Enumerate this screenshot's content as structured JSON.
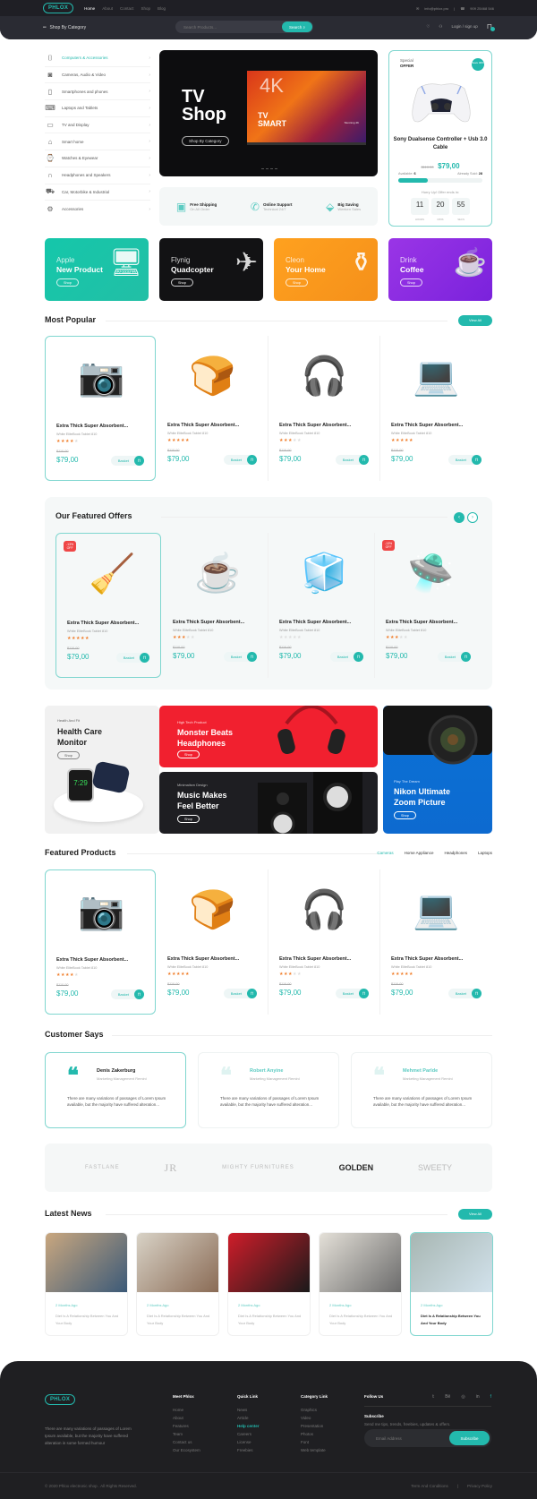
{
  "header": {
    "logo": "PHLOX",
    "nav": [
      "Home",
      "About",
      "Contact",
      "Shop",
      "Blog"
    ],
    "email": "info@phlox.pro",
    "phone": "909 25468 546",
    "category_button": "Shop By Category",
    "search_placeholder": "Search Products...",
    "search_button": "Search",
    "login": "Login / sign up",
    "accent_color": "#23b9ad"
  },
  "sidebar": {
    "items": [
      {
        "label": "Computers & Accessories",
        "icon": "mouse-icon",
        "active": true
      },
      {
        "label": "Cameras, Audio & Video",
        "icon": "camera-icon"
      },
      {
        "label": "Smartphones and phones",
        "icon": "smartphone-icon"
      },
      {
        "label": "Laptops and Tablets",
        "icon": "laptop-icon"
      },
      {
        "label": "TV and Display",
        "icon": "tv-icon"
      },
      {
        "label": "Smart home",
        "icon": "home-icon"
      },
      {
        "label": "Watches & Eyewear",
        "icon": "watch-icon"
      },
      {
        "label": "Headphones and Speakers",
        "icon": "headphones-icon"
      },
      {
        "label": "Car, Motorbike & Industrial",
        "icon": "car-icon"
      },
      {
        "label": "Accessories",
        "icon": "accessories-icon"
      }
    ]
  },
  "hero": {
    "title_line1": "TV",
    "title_line2": "Shop",
    "button": "Shop By Category",
    "tv_badge": "4K",
    "tv_text_line1": "TV",
    "tv_text_line2": "SMART",
    "tv_sub": "Stunning 4K"
  },
  "features": [
    {
      "title": "Free Shipping",
      "sub": "On All Order",
      "icon": "shipping-box-icon"
    },
    {
      "title": "Online Support",
      "sub": "Technical 24/7",
      "icon": "support-phone-icon"
    },
    {
      "title": "Big Saving",
      "sub": "Weeken Sales",
      "icon": "saving-tag-icon"
    }
  ],
  "special_offer": {
    "label_line1": "Special",
    "label_line2": "OFFER",
    "save_badge": "Save 30%",
    "title": "Sony Dualsense Controller + Usb 3.0 Cable",
    "old_price": "$110.00",
    "price": "$79,00",
    "available_label": "Available:",
    "available": "6",
    "sold_label": "Already Sold:",
    "sold": "28",
    "progress_percent": 35,
    "hurry_text": "Hurry Up! Offer ends in:",
    "timer": [
      {
        "value": "11",
        "unit": "HOURS"
      },
      {
        "value": "20",
        "unit": "MINS"
      },
      {
        "value": "55",
        "unit": "SECS"
      }
    ]
  },
  "promos": [
    {
      "line1": "Apple",
      "line2": "New Product",
      "button": "Shop",
      "color": "#1fc7a9"
    },
    {
      "line1": "Flynig",
      "line2": "Quadcopter",
      "button": "Shop",
      "color": "#141416"
    },
    {
      "line1": "Cleon",
      "line2": "Your Home",
      "button": "Shop",
      "color": "#f79a1e"
    },
    {
      "line1": "Drink",
      "line2": "Coffee",
      "button": "Shop",
      "color": "#8f2be0"
    }
  ],
  "most_popular": {
    "title": "Most Popular",
    "view_all": "View All",
    "products": [
      {
        "name": "Extra Thick Super Absorbent...",
        "sub": "White EliteBook Tablet 810",
        "rating": 4,
        "old_price": "$110.00",
        "price": "$79,00",
        "basket": "Basket",
        "image": "camera"
      },
      {
        "name": "Extra Thick Super Absorbent...",
        "sub": "White EliteBook Tablet 810",
        "rating": 5,
        "old_price": "$110.00",
        "price": "$79,00",
        "basket": "Basket",
        "image": "toaster"
      },
      {
        "name": "Extra Thick Super Absorbent...",
        "sub": "White EliteBook Tablet 810",
        "rating": 3,
        "old_price": "$110.00",
        "price": "$79,00",
        "basket": "Basket",
        "image": "headphones"
      },
      {
        "name": "Extra Thick Super Absorbent...",
        "sub": "White EliteBook Tablet 810",
        "rating": 5,
        "old_price": "$110.00",
        "price": "$79,00",
        "basket": "Basket",
        "image": "laptop"
      }
    ]
  },
  "featured_offers": {
    "title": "Our Featured Offers",
    "products": [
      {
        "name": "Extra Thick Super Absorbent...",
        "sub": "White EliteBook Tablet 810",
        "rating": 5,
        "old_price": "$110.00",
        "price": "$79,00",
        "basket": "Basket",
        "discount": "-13%",
        "discount_sub": "OFF",
        "image": "vacuum"
      },
      {
        "name": "Extra Thick Super Absorbent...",
        "sub": "White EliteBook Tablet 810",
        "rating": 3,
        "old_price": "$110.00",
        "price": "$79,00",
        "basket": "Basket",
        "image": "coffee-machine"
      },
      {
        "name": "Extra Thick Super Absorbent...",
        "sub": "White EliteBook Tablet 810",
        "rating": 0,
        "old_price": "$110.00",
        "price": "$79,00",
        "basket": "Basket",
        "image": "fridge"
      },
      {
        "name": "Extra Thick Super Absorbent...",
        "sub": "White EliteBook Tablet 810",
        "rating": 3,
        "old_price": "$110.00",
        "price": "$79,00",
        "basket": "Basket",
        "discount": "-13%",
        "discount_sub": "OFF",
        "image": "drone"
      }
    ]
  },
  "mosaic": {
    "health": {
      "kicker": "Health And Fit",
      "title_line1": "Health Care",
      "title_line2": "Monitor",
      "button": "Shop",
      "watch_time": "7:29"
    },
    "beats": {
      "kicker": "High Tech Product",
      "title_line1": "Monster Beats",
      "title_line2": "Headphones",
      "button": "Shop"
    },
    "music": {
      "kicker": "Minimalism Design",
      "title_line1": "Music Makes",
      "title_line2": "Feel Better",
      "button": "Shop"
    },
    "nikon": {
      "kicker": "Play The Dream",
      "title_line1": "Nikon Ultimate",
      "title_line2": "Zoom Picture",
      "button": "Shop"
    }
  },
  "featured_products": {
    "title": "Featured Products",
    "tabs": [
      "Cameras",
      "Home Appliance",
      "Headphones",
      "Laptops"
    ],
    "products": [
      {
        "name": "Extra Thick Super Absorbent...",
        "sub": "White EliteBook Tablet 810",
        "rating": 4,
        "old_price": "$110.00",
        "price": "$79,00",
        "basket": "Basket",
        "image": "camera"
      },
      {
        "name": "Extra Thick Super Absorbent...",
        "sub": "White EliteBook Tablet 810",
        "rating": 5,
        "old_price": "$110.00",
        "price": "$79,00",
        "basket": "Basket",
        "image": "toaster"
      },
      {
        "name": "Extra Thick Super Absorbent...",
        "sub": "White EliteBook Tablet 810",
        "rating": 3,
        "old_price": "$110.00",
        "price": "$79,00",
        "basket": "Basket",
        "image": "headphones"
      },
      {
        "name": "Extra Thick Super Absorbent...",
        "sub": "White EliteBook Tablet 810",
        "rating": 5,
        "old_price": "$110.00",
        "price": "$79,00",
        "basket": "Basket",
        "image": "laptop"
      }
    ]
  },
  "testimonials": {
    "title": "Customer Says",
    "items": [
      {
        "name": "Denis Zakerburg",
        "role": "Marketing Management Remini",
        "text": "There are many variations of passages of Lorem Ipsum available, but the majority have suffered alteration..."
      },
      {
        "name": "Robert Anyine",
        "role": "Marketing Management Remini",
        "text": "There are many variations of passages of Lorem Ipsum available, but the majority have suffered alteration..."
      },
      {
        "name": "Mehmet Parlde",
        "role": "Marketing Management Remini",
        "text": "There are many variations of passages of Lorem Ipsum available, but the majority have suffered alteration..."
      }
    ]
  },
  "brands": [
    "FASTLANE",
    "JR",
    "MIGHTY FURNITURES",
    "GOLDEN",
    "SWEETY"
  ],
  "news": {
    "title": "Latest News",
    "view_all": "View All",
    "items": [
      {
        "ago": "2 Months Ago",
        "title": "Diet Is A Relationship Between You And Your Body",
        "colors": [
          "#c9a77f",
          "#3c5a78"
        ]
      },
      {
        "ago": "2 Months Ago",
        "title": "Diet Is A Relationship Between You And Your Body",
        "colors": [
          "#d8d2c6",
          "#8a6b55"
        ]
      },
      {
        "ago": "2 Months Ago",
        "title": "Diet Is A Relationship Between You And Your Body",
        "colors": [
          "#cf1d2a",
          "#1a1a1a"
        ]
      },
      {
        "ago": "2 Months Ago",
        "title": "Diet Is A Relationship Between You And Your Body",
        "colors": [
          "#e4e0d8",
          "#6b6b6b"
        ]
      },
      {
        "ago": "2 Months Ago",
        "title": "Diet Is A Relationship Between You And Your Body",
        "colors": [
          "#a7b6b2",
          "#d2e2ec"
        ]
      }
    ]
  },
  "footer": {
    "logo": "PHLOX",
    "description": "There are many variations of passages of Lorem Ipsum available, but the majority have suffered alteration in some formed humour",
    "columns": [
      {
        "title": "Meet Phlox",
        "links": [
          "Home",
          "About",
          "Features",
          "Team",
          "Contact us",
          "Our Ecosystem"
        ]
      },
      {
        "title": "Quick Link",
        "links": [
          "News",
          "Article",
          "Help center",
          "Careers",
          "License",
          "Freebies"
        ],
        "highlight": 2
      },
      {
        "title": "Category Link",
        "links": [
          "Graphics",
          "Video",
          "Presentation",
          "Photos",
          "Font",
          "Web template"
        ]
      }
    ],
    "follow_us": "Follow Us",
    "social": [
      "twitter-icon",
      "behance-icon",
      "instagram-icon",
      "linkedin-icon",
      "facebook-icon"
    ],
    "subscribe_title": "Subscribe",
    "subscribe_text": "Send me tips, trends, freebies, updates & offers.",
    "email_placeholder": "Email Address",
    "subscribe_button": "Subscribe",
    "copyright": "© 2020 Phlox electronic shop . All Rights Reserved.",
    "terms": "Term And Conditions",
    "privacy": "Privacy Policy"
  }
}
